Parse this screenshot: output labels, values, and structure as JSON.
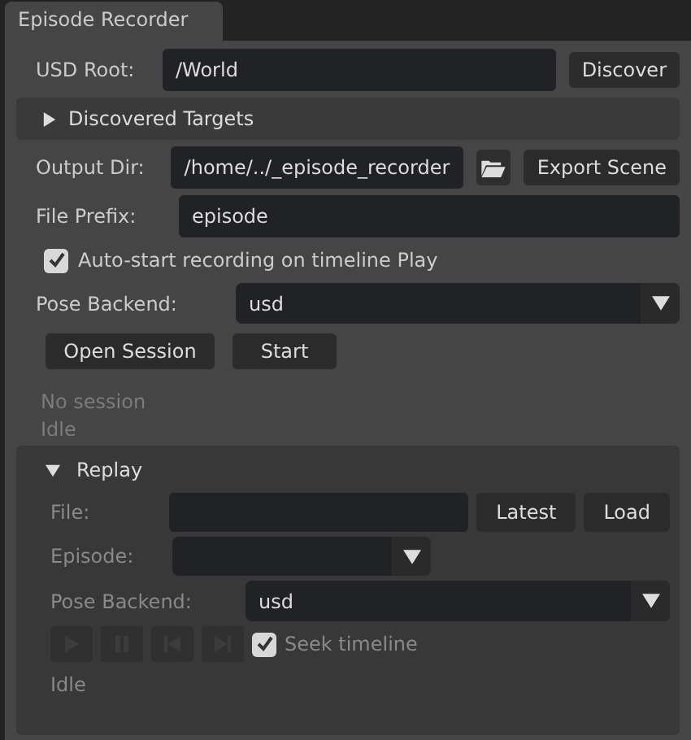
{
  "window": {
    "title": "Episode Recorder"
  },
  "usd_root": {
    "label": "USD Root:",
    "value": "/World",
    "button": "Discover"
  },
  "discovered_targets": {
    "label": "Discovered Targets",
    "expanded": false
  },
  "output_dir": {
    "label": "Output Dir:",
    "value": "/home/../_episode_recorder",
    "button": "Export Scene"
  },
  "file_prefix": {
    "label": "File Prefix:",
    "value": "episode"
  },
  "auto_start": {
    "label": "Auto-start recording on timeline Play",
    "checked": true
  },
  "pose_backend": {
    "label": "Pose Backend:",
    "value": "usd"
  },
  "session_buttons": [
    "Open Session",
    "Start"
  ],
  "session_status": "No session",
  "status": "Idle",
  "replay": {
    "label": "Replay",
    "expanded": true,
    "file": {
      "label": "File:",
      "buttons": [
        "Latest",
        "Load"
      ]
    },
    "episode": {
      "label": "Episode:"
    },
    "pose_backend": {
      "label": "Pose Backend:",
      "value": "usd"
    },
    "transport": [
      {
        "kind": "play",
        "disabled": true
      },
      {
        "kind": "pause",
        "disabled": true
      },
      {
        "kind": "prev",
        "disabled": true
      },
      {
        "kind": "next",
        "disabled": true
      }
    ],
    "seek": {
      "label": "Seek timeline",
      "checked": true
    },
    "status": "Idle"
  }
}
